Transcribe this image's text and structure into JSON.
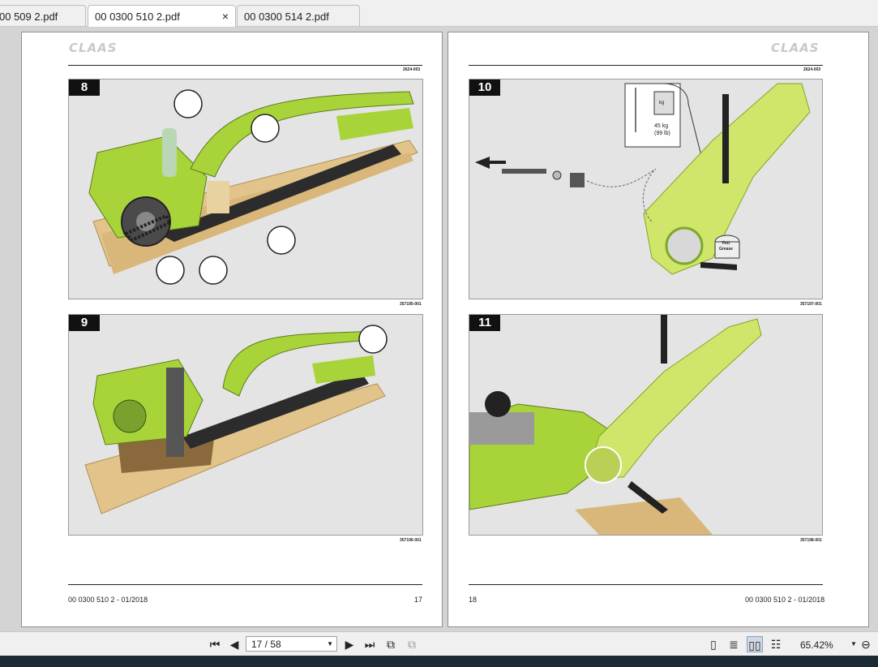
{
  "tabs": [
    {
      "label": "00 509 2.pdf",
      "active": false
    },
    {
      "label": "00 0300 510 2.pdf",
      "active": true,
      "close": "×"
    },
    {
      "label": "00 0300 514 2.pdf",
      "active": false
    }
  ],
  "left_page": {
    "logo": "CLAAS",
    "doc_ref": "2624-003",
    "figures": [
      {
        "number": "8",
        "id": "357195-001"
      },
      {
        "number": "9",
        "id": "357196-001"
      }
    ],
    "footer_left": "00 0300 510 2 - 01/2018",
    "footer_right": "17"
  },
  "right_page": {
    "logo": "CLAAS",
    "doc_ref": "2624-003",
    "figures": [
      {
        "number": "10",
        "id": "357197-001",
        "weight_unit": "kg",
        "weight_label_1": "45 kg",
        "weight_label_2": "(99 lb)",
        "grease_label_1": "Fett",
        "grease_label_2": "Grease"
      },
      {
        "number": "11",
        "id": "357198-001"
      }
    ],
    "footer_left": "18",
    "footer_right": "00 0300 510 2 - 01/2018"
  },
  "toolbar": {
    "page_indicator": "17 / 58",
    "zoom": "65.42%",
    "icons": [
      "first-page-icon",
      "prev-page-icon",
      "next-page-icon",
      "last-page-icon",
      "rotate-icon",
      "copy-icon",
      "single-page-icon",
      "continuous-icon",
      "two-page-icon",
      "two-page-continuous-icon",
      "zoom-dropdown-icon",
      "zoom-out-icon"
    ]
  },
  "colors": {
    "accent_green": "#a8d43a",
    "dark_green": "#7ea82a"
  }
}
